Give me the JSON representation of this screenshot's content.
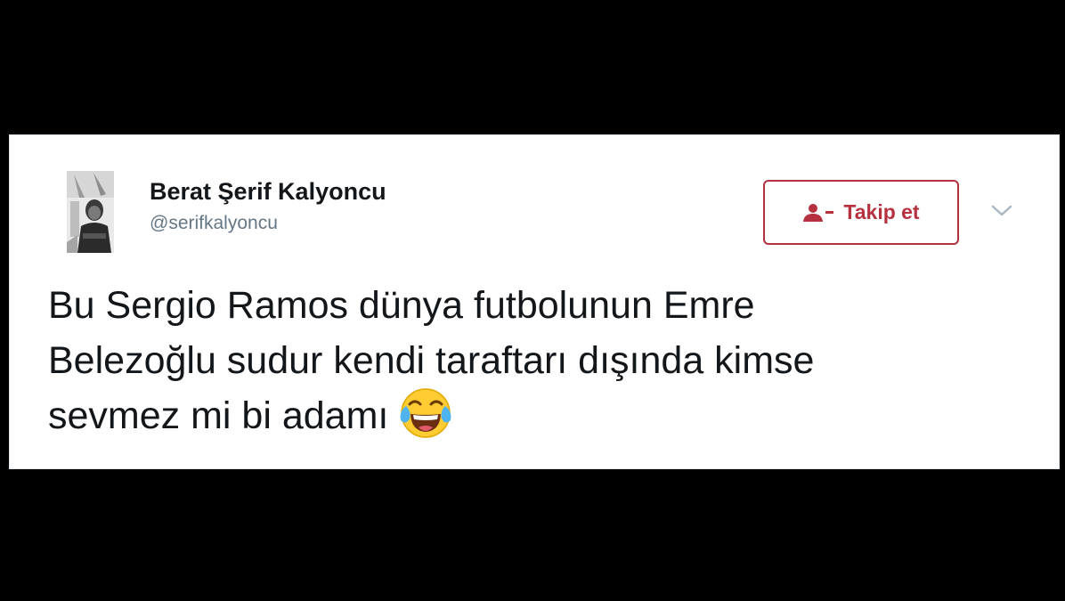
{
  "tweet": {
    "author": {
      "display_name": "Berat Şerif Kalyoncu",
      "handle": "@serifkalyoncu",
      "avatar_icon": "profile-photo"
    },
    "follow_button": {
      "label": "Takip et",
      "icon": "follow-user-icon",
      "color": "#b5313f"
    },
    "menu_icon": "chevron-down-icon",
    "text_lines": [
      "Bu Sergio Ramos dünya futbolunun Emre",
      "Belezoğlu sudur kendi taraftarı dışında kimse",
      "sevmez mi bi adamı"
    ],
    "emoji": "face-with-tears-of-joy"
  }
}
